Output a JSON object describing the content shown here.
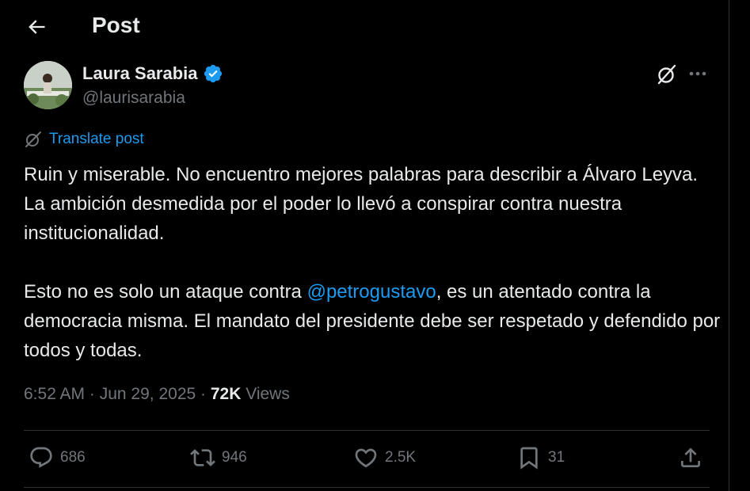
{
  "header": {
    "title": "Post"
  },
  "author": {
    "name": "Laura Sarabia",
    "handle": "@laurisarabia"
  },
  "translate_label": "Translate post",
  "post": {
    "p1": "Ruin y miserable. No encuentro mejores palabras para describir a Álvaro Leyva. La ambición desmedida por el poder lo llevó a conspirar contra nuestra institucionalidad.",
    "p2_before": "Esto no es solo un ataque contra ",
    "mention": "@petrogustavo",
    "p2_after": ", es un atentado contra la democracia misma. El mandato del presidente debe ser respetado y defendido por todos y todas."
  },
  "meta": {
    "time": "6:52 AM",
    "sep1": " · ",
    "date": "Jun 29, 2025",
    "sep2": " · ",
    "views_count": "72K",
    "views_label": " Views"
  },
  "actions": {
    "replies": "686",
    "reposts": "946",
    "likes": "2.5K",
    "bookmarks": "31"
  },
  "colors": {
    "background": "#000000",
    "text": "#e7e9ea",
    "secondary": "#71767b",
    "accent": "#1d9bf0",
    "divider": "#2f3336"
  },
  "icons": [
    "back-arrow-icon",
    "verified-badge-icon",
    "grok-icon",
    "more-icon",
    "translate-icon",
    "reply-icon",
    "repost-icon",
    "like-icon",
    "bookmark-icon",
    "share-icon"
  ]
}
